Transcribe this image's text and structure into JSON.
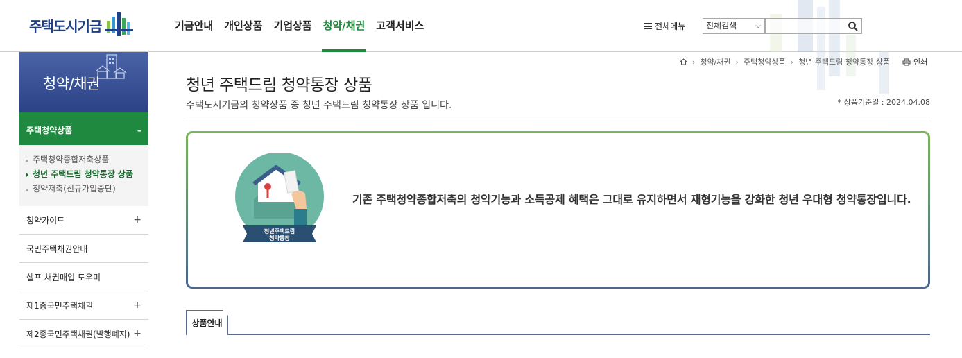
{
  "header": {
    "logo_text": "주택도시기금",
    "gnb": [
      {
        "label": "기금안내",
        "active": false
      },
      {
        "label": "개인상품",
        "active": false
      },
      {
        "label": "기업상품",
        "active": false
      },
      {
        "label": "청약/채권",
        "active": true
      },
      {
        "label": "고객서비스",
        "active": false
      }
    ],
    "all_menu_label": "전체메뉴",
    "search_select_value": "전체검색",
    "search_placeholder": ""
  },
  "sidebar": {
    "title": "청약/채권",
    "active_group": "주택청약상품",
    "active_group_toggle": "–",
    "sub_items": [
      {
        "label": "주택청약종합저축상품",
        "current": false
      },
      {
        "label": "청년 주택드림 청약통장 상품",
        "current": true
      },
      {
        "label": "청약저축(신규가입중단)",
        "current": false
      }
    ],
    "items": [
      {
        "label": "청약가이드",
        "toggle": "+"
      },
      {
        "label": "국민주택채권안내",
        "toggle": ""
      },
      {
        "label": "셀프 채권매입 도우미",
        "toggle": ""
      },
      {
        "label": "제1종국민주택채권",
        "toggle": "+"
      },
      {
        "label": "제2종국민주택채권(발행폐지)",
        "toggle": "+"
      }
    ]
  },
  "breadcrumb": [
    "청약/채권",
    "주택청약상품",
    "청년 주택드림 청약통장 상품"
  ],
  "print_label": "인쇄",
  "main": {
    "title": "청년 주택드림 청약통장 상품",
    "description": "주택도시기금의 청약상품 중 청년 주택드림 청약통장 상품 입니다.",
    "base_date": "* 상품기준일 : 2024.04.08",
    "illust_label_line1": "청년주택드림",
    "illust_label_line2": "청약통장",
    "info_text": "기존 주택청약종합저축의 청약기능과 소득공제 혜택은 그대로 유지하면서 재형기능을 강화한 청년 우대형 청약통장입니다.",
    "tab_label": "상품안내"
  },
  "colors": {
    "brand_navy": "#1f3f86",
    "accent_green": "#1b8a3a",
    "sidebar_blue": "#2b4386"
  }
}
